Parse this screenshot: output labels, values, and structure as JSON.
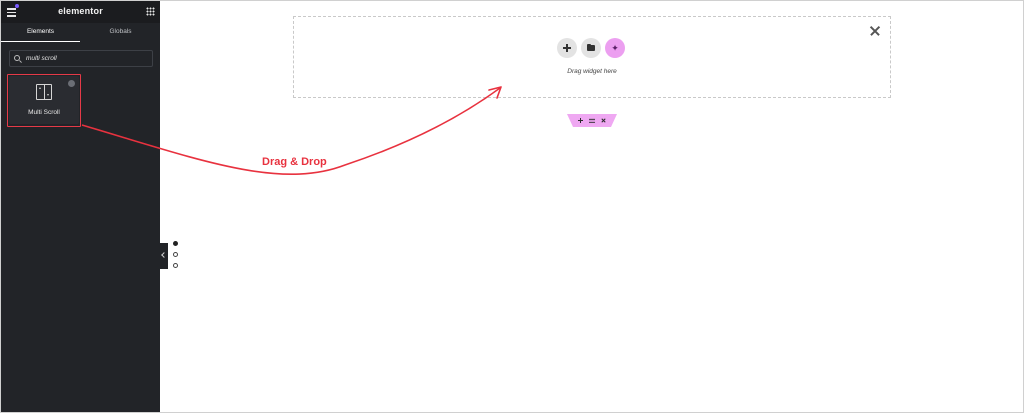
{
  "app": {
    "brand": "elementor"
  },
  "sidebar": {
    "tabs": [
      {
        "label": "Elements",
        "active": true
      },
      {
        "label": "Globals",
        "active": false
      }
    ],
    "search": {
      "value": "multi scroll",
      "placeholder": "Search Widget..."
    },
    "widget": {
      "label": "Multi Scroll",
      "icon": "multi-scroll-icon"
    }
  },
  "canvas": {
    "drop_hint": "Drag widget here",
    "buttons": [
      "add-section-icon",
      "template-library-icon",
      "ai-sparkle-icon"
    ],
    "section_handle": [
      "add-icon",
      "drag-handle-icon",
      "delete-icon"
    ],
    "page_dots": {
      "count": 3,
      "active_index": 0
    }
  },
  "annotation": {
    "label": "Drag & Drop",
    "color": "#e8323f"
  },
  "colors": {
    "sidebar_bg": "#222428",
    "accent_pink": "#efa8f2",
    "highlight_red": "#e53a48"
  }
}
